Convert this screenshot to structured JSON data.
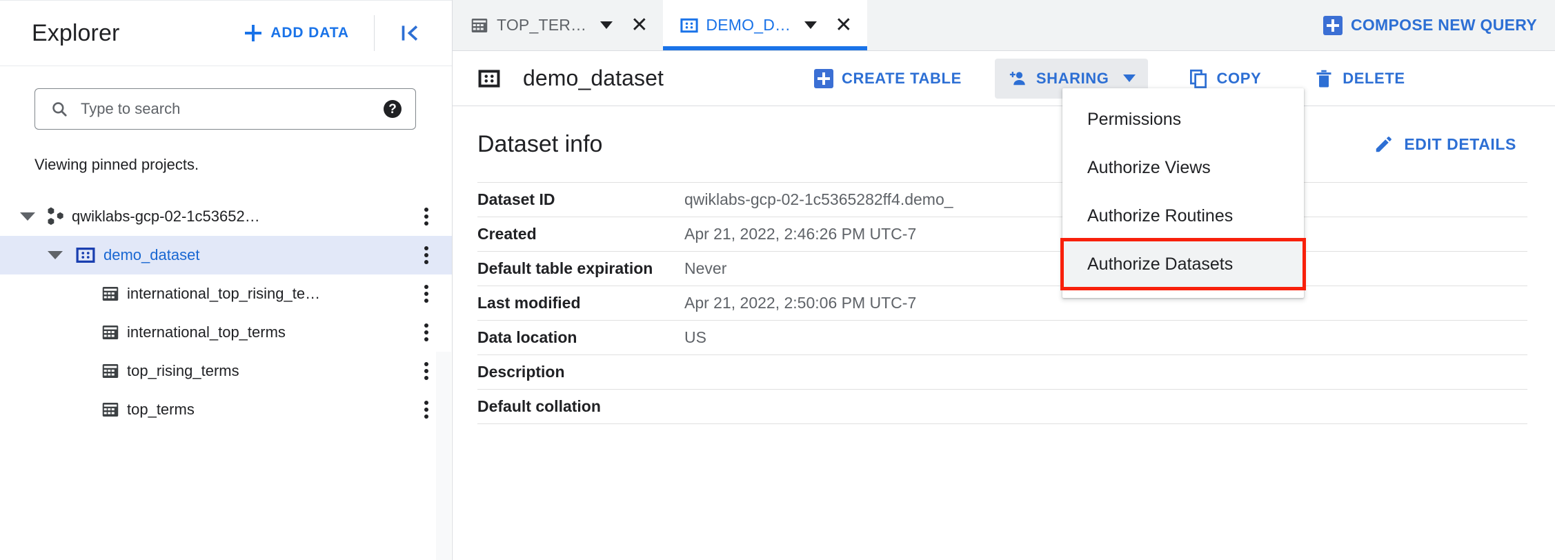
{
  "sidebar": {
    "title": "Explorer",
    "add_data_label": "ADD DATA",
    "collapse_icon": "collapse-panel-icon",
    "search": {
      "placeholder": "Type to search",
      "value": "",
      "search_icon": "search-icon",
      "help_icon": "help-icon"
    },
    "pinned_note": "Viewing pinned projects.",
    "tree": [
      {
        "label": "qwiklabs-gcp-02-1c53652…",
        "icon": "project-nodes-icon",
        "level": 0,
        "expanded": true,
        "selected": false,
        "menu_icon": "more-vert-icon"
      },
      {
        "label": "demo_dataset",
        "icon": "dataset-icon",
        "level": 1,
        "expanded": true,
        "selected": true,
        "menu_icon": "more-vert-icon"
      },
      {
        "label": "international_top_rising_te…",
        "icon": "table-icon",
        "level": 2,
        "expanded": null,
        "selected": false,
        "menu_icon": "more-vert-icon"
      },
      {
        "label": "international_top_terms",
        "icon": "table-icon",
        "level": 2,
        "expanded": null,
        "selected": false,
        "menu_icon": "more-vert-icon"
      },
      {
        "label": "top_rising_terms",
        "icon": "table-icon",
        "level": 2,
        "expanded": null,
        "selected": false,
        "menu_icon": "more-vert-icon"
      },
      {
        "label": "top_terms",
        "icon": "table-icon",
        "level": 2,
        "expanded": null,
        "selected": false,
        "menu_icon": "more-vert-icon"
      }
    ]
  },
  "tabs": [
    {
      "label": "TOP_TER…",
      "icon": "table-icon",
      "active": false,
      "caret": "chevron-down-icon",
      "close": "close-icon"
    },
    {
      "label": "DEMO_D…",
      "icon": "dataset-icon",
      "active": true,
      "caret": "chevron-down-icon",
      "close": "close-icon"
    }
  ],
  "compose": {
    "label": "COMPOSE NEW QUERY",
    "icon": "add-box-icon"
  },
  "toolbar": {
    "dataset_icon": "dataset-icon",
    "dataset_name": "demo_dataset",
    "create_table_label": "CREATE TABLE",
    "create_table_icon": "add-box-icon",
    "sharing_label": "SHARING",
    "sharing_icon": "person-add-icon",
    "sharing_caret": "chevron-down-icon",
    "copy_label": "COPY",
    "copy_icon": "copy-icon",
    "delete_label": "DELETE",
    "delete_icon": "trash-icon"
  },
  "sharing_menu": {
    "items": [
      {
        "label": "Permissions",
        "hover": false,
        "annotated": false
      },
      {
        "label": "Authorize Views",
        "hover": false,
        "annotated": false
      },
      {
        "label": "Authorize Routines",
        "hover": false,
        "annotated": false
      },
      {
        "label": "Authorize Datasets",
        "hover": true,
        "annotated": true
      }
    ],
    "annotation_color": "#f8200b"
  },
  "main": {
    "section_title": "Dataset info",
    "edit_label": "EDIT DETAILS",
    "edit_icon": "pencil-icon",
    "rows": [
      {
        "key": "Dataset ID",
        "value": "qwiklabs-gcp-02-1c5365282ff4.demo_"
      },
      {
        "key": "Created",
        "value": "Apr 21, 2022, 2:46:26 PM UTC-7"
      },
      {
        "key": "Default table expiration",
        "value": "Never"
      },
      {
        "key": "Last modified",
        "value": "Apr 21, 2022, 2:50:06 PM UTC-7"
      },
      {
        "key": "Data location",
        "value": "US"
      },
      {
        "key": "Description",
        "value": ""
      },
      {
        "key": "Default collation",
        "value": ""
      }
    ]
  },
  "colors": {
    "accent": "#1a73e8",
    "accent_dark": "#2d6fd4",
    "selected_row": "#e2e8f8",
    "tabbar_bg": "#f1f3f4",
    "text": "#202124",
    "muted": "#5f6368"
  }
}
